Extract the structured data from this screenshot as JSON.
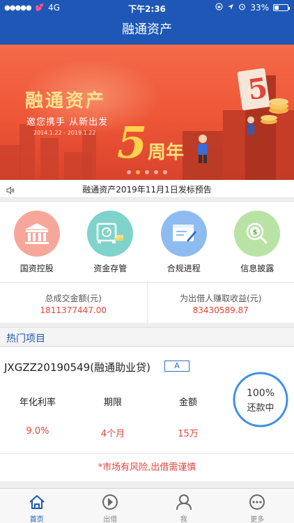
{
  "status_bar": {
    "signal": "●●●●●",
    "carrier_extra": "💕",
    "network": "4G",
    "time": "下午2:36",
    "battery": "33%",
    "battery_level": 0.33
  },
  "nav": {
    "title": "融通资产"
  },
  "banner": {
    "title": "融通资产",
    "subtitle": "邀您携手 从新出发",
    "dates": "2014.1.22 - 2019.1.22",
    "anniversary_digit": "5",
    "anniversary_word": "周年",
    "slide_count": 5,
    "active_slide": 1
  },
  "notice": {
    "text": "融通资产2019年11月1日发标预告"
  },
  "features": [
    {
      "label": "国资控股",
      "icon": "bank-icon",
      "color": "#f7a79a"
    },
    {
      "label": "资金存管",
      "icon": "safe-icon",
      "color": "#7fd3cb"
    },
    {
      "label": "合规进程",
      "icon": "certificate-icon",
      "color": "#8fbcf0"
    },
    {
      "label": "信息披露",
      "icon": "dollar-search-icon",
      "color": "#b9e3a5"
    }
  ],
  "stats": [
    {
      "label": "总成交金额(元)",
      "value": "1811377447.00"
    },
    {
      "label": "为出借人赚取收益(元)",
      "value": "83430589.87"
    }
  ],
  "hot": {
    "header": "热门项目",
    "project": {
      "name": "JXGZZ20190549(融通助业贷)",
      "grade": "A",
      "rate_label": "年化利率",
      "rate": "9.0%",
      "term_label": "期限",
      "term": "4个月",
      "amount_label": "金额",
      "amount": "15万",
      "progress_text": "100%",
      "progress": 1.0,
      "status": "还款中"
    },
    "risk_warning": "*市场有风险,出借需谨慎"
  },
  "tabs": [
    {
      "label": "首页",
      "icon": "home-icon",
      "active": true
    },
    {
      "label": "出借",
      "icon": "invest-icon",
      "active": false
    },
    {
      "label": "我",
      "icon": "user-icon",
      "active": false
    },
    {
      "label": "更多",
      "icon": "more-icon",
      "active": false
    }
  ],
  "colors": {
    "brand": "#1e57b5",
    "accent_red": "#e8443a",
    "banner": "#ee5637"
  }
}
